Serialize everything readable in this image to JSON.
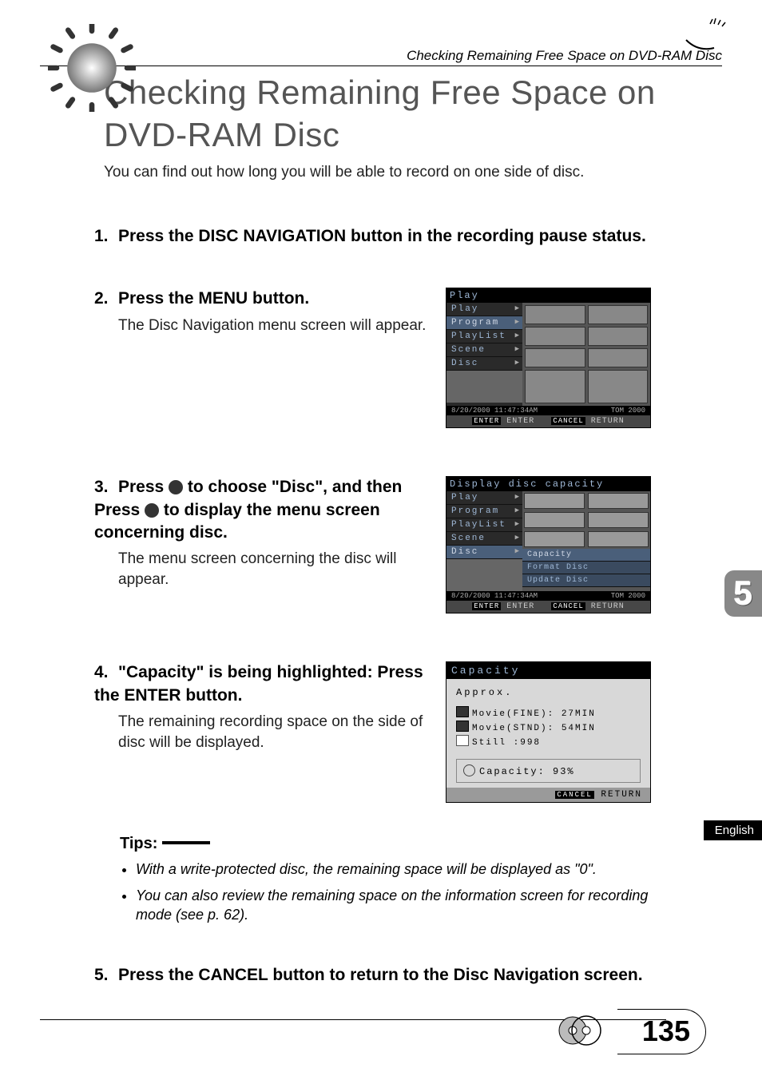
{
  "header_breadcrumb": "Checking Remaining Free Space on DVD-RAM Disc",
  "title": "Checking Remaining Free Space on DVD-RAM Disc",
  "intro": "You can find out how long you will be able to record on one side of disc.",
  "steps": {
    "1": {
      "head": "Press the DISC NAVIGATION button in the recording pause status."
    },
    "2": {
      "head": "Press the MENU button.",
      "body": "The Disc Navigation menu screen will appear."
    },
    "3": {
      "head_a": "Press ",
      "head_b": " to choose \"Disc\", and then Press ",
      "head_c": " to display the menu screen concerning disc.",
      "body": "The menu screen concerning the disc will appear."
    },
    "4": {
      "head": "\"Capacity\" is being highlighted: Press the ENTER button.",
      "body": "The remaining recording space on the side of disc will be displayed."
    },
    "5": {
      "head": "Press the CANCEL button to return to the Disc Navigation screen."
    }
  },
  "screen_a": {
    "title": "Play",
    "menu": [
      "Play",
      "Program",
      "PlayList",
      "Scene",
      "Disc"
    ],
    "highlight_index": 1,
    "status_left": "8/20/2000 11:47:34AM",
    "status_right": "TOM 2000",
    "footer_enter": "ENTER",
    "footer_enter_label": "ENTER",
    "footer_cancel": "CANCEL",
    "footer_cancel_label": "RETURN"
  },
  "screen_b": {
    "title": "Display disc capacity",
    "menu": [
      "Play",
      "Program",
      "PlayList",
      "Scene",
      "Disc"
    ],
    "highlight_index": 4,
    "submenu": [
      "Capacity",
      "Format Disc",
      "Update Disc"
    ],
    "submenu_highlight_index": 0,
    "status_left": "8/20/2000 11:47:34AM",
    "status_right": "TOM 2000",
    "footer_enter": "ENTER",
    "footer_enter_label": "ENTER",
    "footer_cancel": "CANCEL",
    "footer_cancel_label": "RETURN"
  },
  "screen_c": {
    "title": "Capacity",
    "approx": "Approx.",
    "lines": [
      {
        "label": "Movie(FINE)",
        "value": ": 27MIN"
      },
      {
        "label": "Movie(STND)",
        "value": ": 54MIN"
      },
      {
        "label": "Still",
        "value": "     :998"
      }
    ],
    "capacity": "Capacity: 93%",
    "footer_cancel": "CANCEL",
    "footer_cancel_label": "RETURN"
  },
  "tips": {
    "title": "Tips:",
    "items": [
      "With a write-protected disc, the remaining space will be displayed as \"0\".",
      "You can also review the remaining space on the information screen for recording mode (see p. 62)."
    ]
  },
  "page_number": "135",
  "chapter_number": "5",
  "language_label": "English"
}
